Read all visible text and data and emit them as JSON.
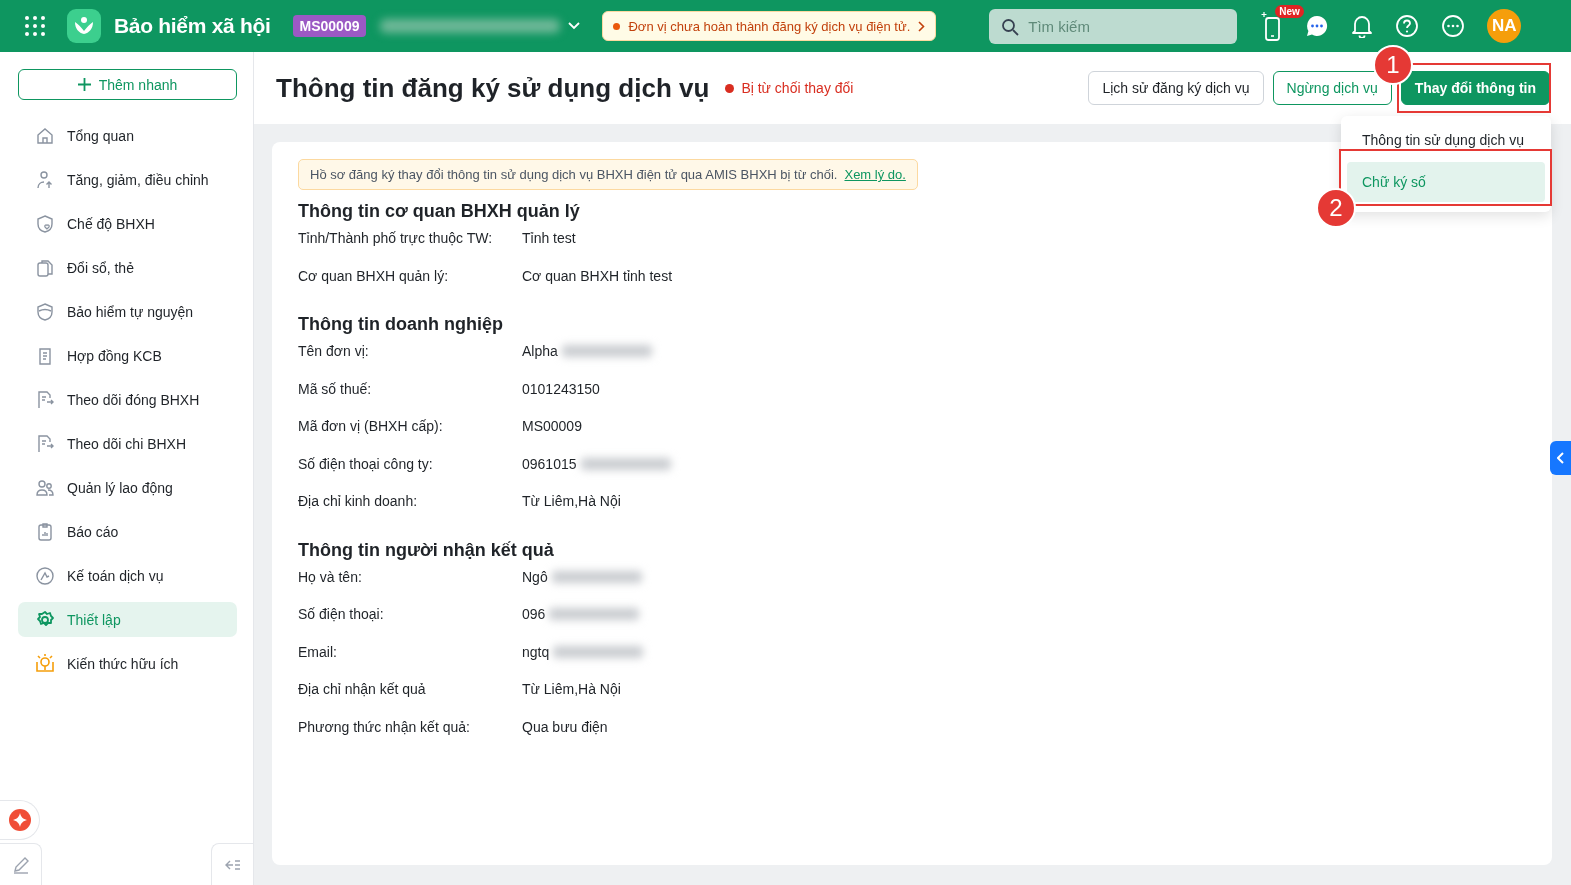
{
  "topbar": {
    "app_title": "Bảo hiểm xã hội",
    "unit_code": "MS00009",
    "notice": "Đơn vị chưa hoàn thành đăng ký dịch vụ điện tử.",
    "search": {
      "placeholder": "Tìm kiếm"
    },
    "new_badge": "New",
    "avatar": "NA"
  },
  "sidebar": {
    "add_button": "Thêm nhanh",
    "items": [
      {
        "label": "Tổng quan",
        "selected": false
      },
      {
        "label": "Tăng, giảm, điều chỉnh",
        "selected": false
      },
      {
        "label": "Chế độ BHXH",
        "selected": false
      },
      {
        "label": "Đổi sổ, thẻ",
        "selected": false
      },
      {
        "label": "Bảo hiểm tự nguyện",
        "selected": false
      },
      {
        "label": "Hợp đồng KCB",
        "selected": false
      },
      {
        "label": "Theo dõi đóng BHXH",
        "selected": false
      },
      {
        "label": "Theo dõi chi BHXH",
        "selected": false
      },
      {
        "label": "Quản lý lao động",
        "selected": false
      },
      {
        "label": "Báo cáo",
        "selected": false
      },
      {
        "label": "Kế toán dịch vụ",
        "selected": false
      },
      {
        "label": "Thiết lập",
        "selected": true
      },
      {
        "label": "Kiến thức hữu ích",
        "selected": false
      }
    ]
  },
  "header": {
    "title": "Thông tin đăng ký sử dụng dịch vụ",
    "status": "Bị từ chối thay đổi",
    "buttons": [
      {
        "label": "Lịch sử đăng ký dịch vụ",
        "kind": "outline"
      },
      {
        "label": "Ngừng dịch vụ",
        "kind": "secondary"
      },
      {
        "label": "Thay đổi thông tin",
        "kind": "primary"
      }
    ]
  },
  "dropdown": {
    "items": [
      {
        "label": "Thông tin sử dụng dịch vụ",
        "selected": false
      },
      {
        "label": "Chữ ký số",
        "selected": true
      }
    ]
  },
  "annotations": [
    {
      "number": "1"
    },
    {
      "number": "2"
    }
  ],
  "alert": {
    "text": "Hồ sơ đăng ký thay đổi thông tin sử dụng dịch vụ BHXH điện tử qua AMIS BHXH bị từ chối.",
    "link": "Xem lý do."
  },
  "sections": [
    {
      "title": "Thông tin cơ quan BHXH quản lý",
      "fields": [
        {
          "label": "Tỉnh/Thành phố trực thuộc TW:",
          "value": "Tỉnh test",
          "redacted": false
        },
        {
          "label": "Cơ quan BHXH quản lý:",
          "value": "Cơ quan BHXH tỉnh test",
          "redacted": false
        }
      ]
    },
    {
      "title": "Thông tin doanh nghiệp",
      "fields": [
        {
          "label": "Tên đơn vị:",
          "value": "Alpha",
          "redacted": true
        },
        {
          "label": "Mã số thuế:",
          "value": "0101243150",
          "redacted": false
        },
        {
          "label": "Mã đơn vị (BHXH cấp):",
          "value": "MS00009",
          "redacted": false
        },
        {
          "label": "Số điện thoại công ty:",
          "value": "0961015",
          "redacted": true
        },
        {
          "label": "Địa chỉ kinh doanh:",
          "value": "Từ Liêm,Hà Nội",
          "redacted": false
        }
      ]
    },
    {
      "title": "Thông tin người nhận kết quả",
      "fields": [
        {
          "label": "Họ và tên:",
          "value": "Ngô",
          "redacted": true
        },
        {
          "label": "Số điện thoại:",
          "value": "096",
          "redacted": true
        },
        {
          "label": "Email:",
          "value": "ngtq",
          "redacted": true
        },
        {
          "label": "Địa chỉ nhận kết quả",
          "value": "Từ Liêm,Hà Nội",
          "redacted": false
        },
        {
          "label": "Phương thức nhận kết quả:",
          "value": "Qua bưu điện",
          "redacted": false
        }
      ]
    }
  ]
}
